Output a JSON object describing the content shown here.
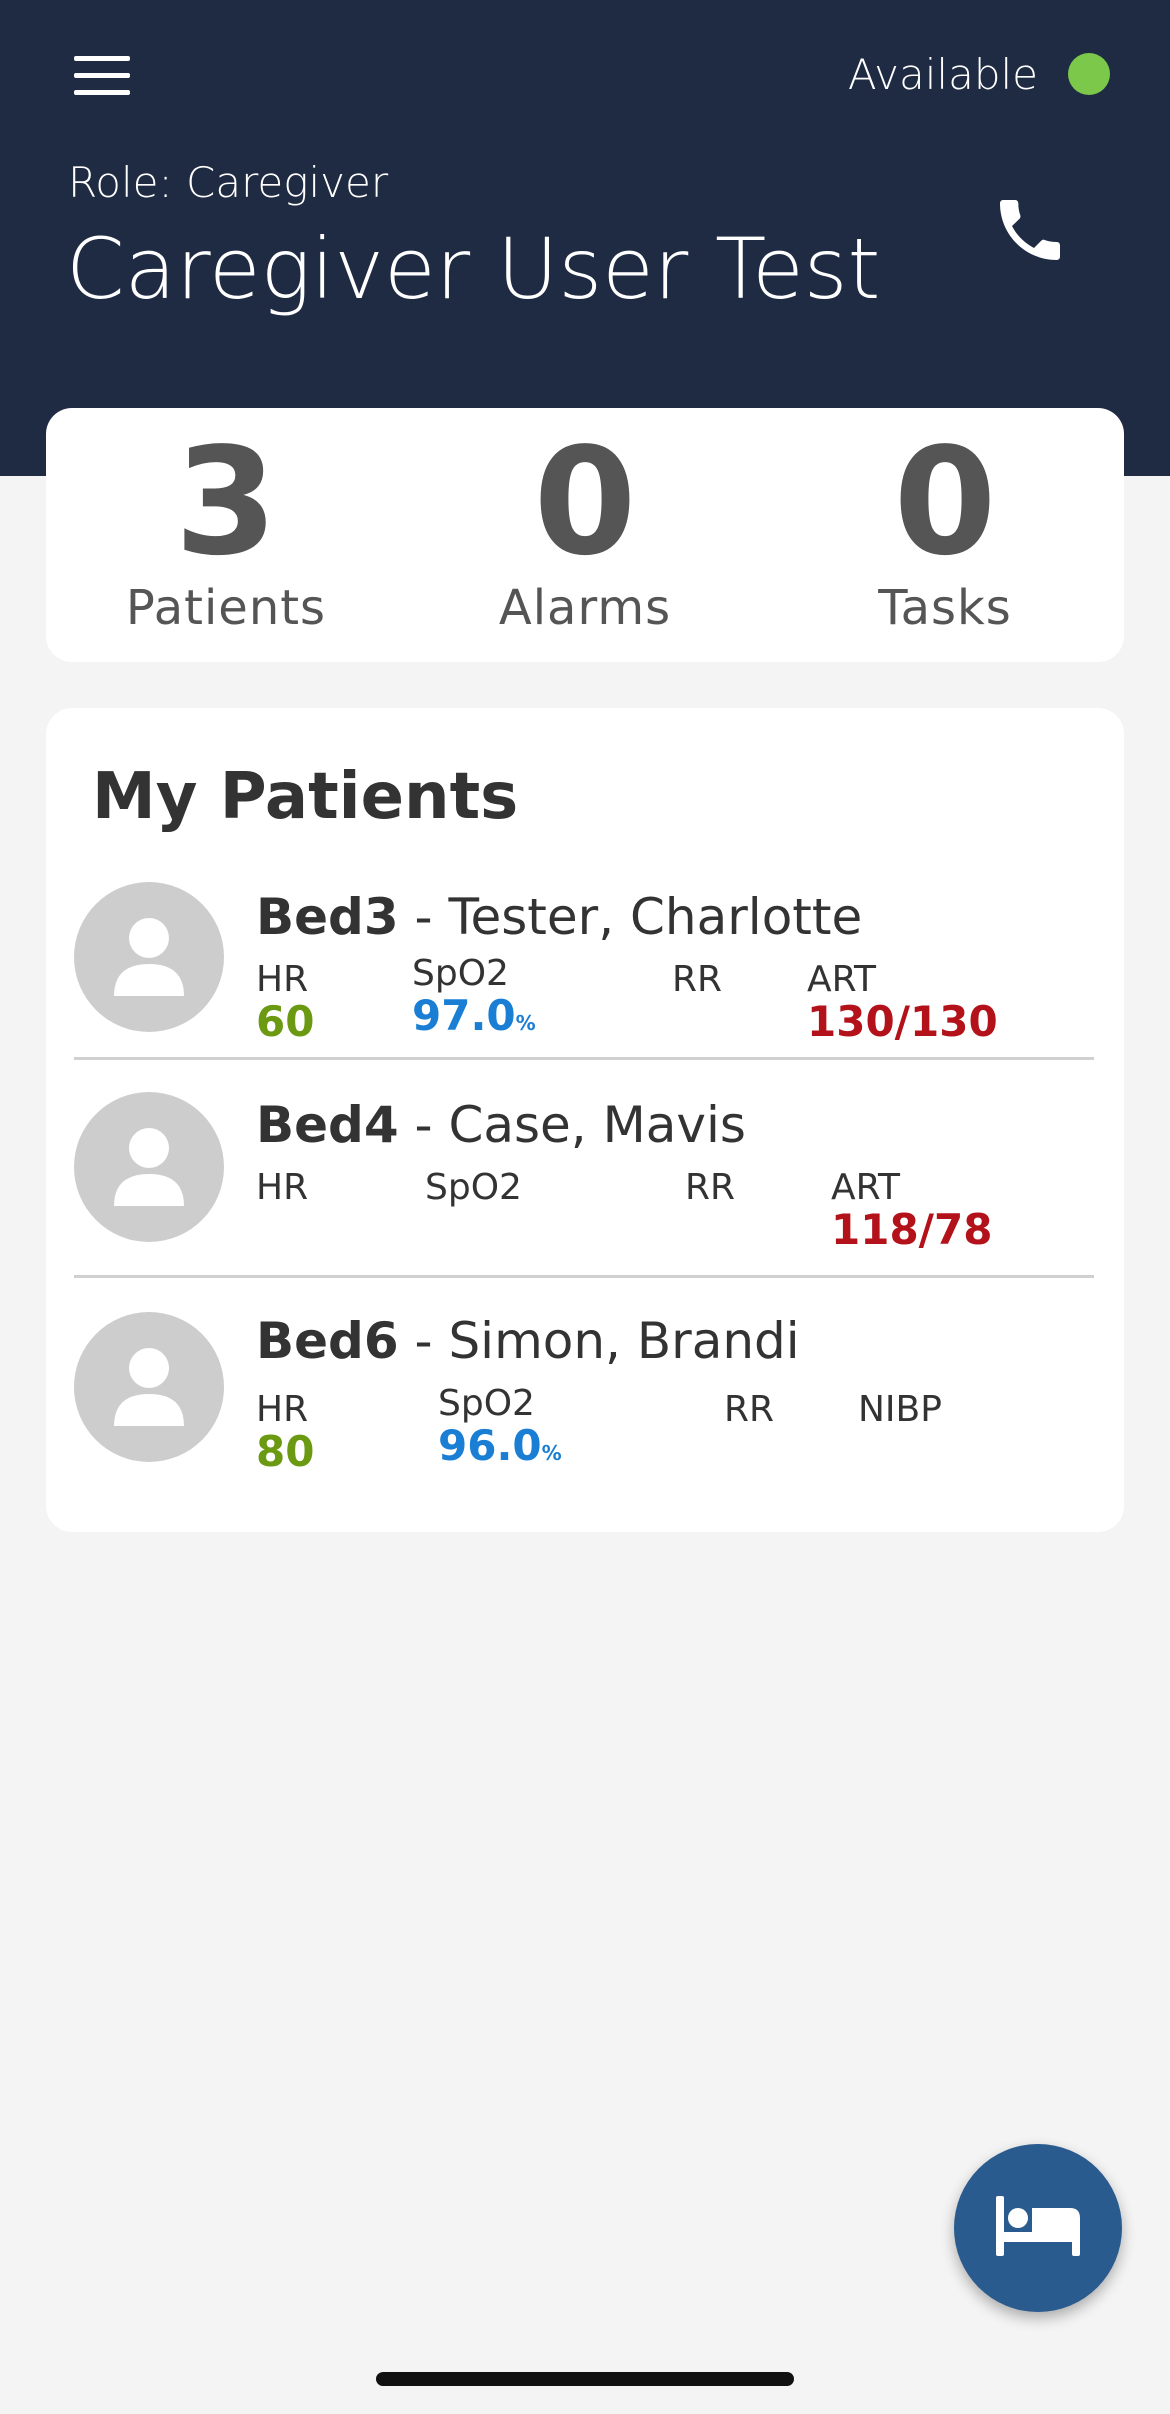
{
  "header": {
    "status_label": "Available",
    "status_color": "#7bc84a",
    "role": "Role: Caregiver",
    "user_name": "Caregiver User Test",
    "menu_icon": "hamburger-menu-icon",
    "call_icon": "phone-icon"
  },
  "summary": {
    "patients_value": "3",
    "patients_label": "Patients",
    "alarms_value": "0",
    "alarms_label": "Alarms",
    "tasks_value": "0",
    "tasks_label": "Tasks"
  },
  "my_patients": {
    "title": "My Patients",
    "patients": [
      {
        "bed": "Bed3",
        "name": " - Tester, Charlotte",
        "vitals": {
          "hr_label": "HR",
          "hr_value": "60",
          "spo2_label": "SpO2",
          "spo2_value": "97.0",
          "spo2_unit": "%",
          "rr_label": "RR",
          "rr_value": "",
          "bp_label": "ART",
          "bp_value": "130/130"
        }
      },
      {
        "bed": "Bed4",
        "name": " - Case, Mavis",
        "vitals": {
          "hr_label": "HR",
          "hr_value": "",
          "spo2_label": "SpO2",
          "spo2_value": "",
          "spo2_unit": "",
          "rr_label": "RR",
          "rr_value": "",
          "bp_label": "ART",
          "bp_value": "118/78"
        }
      },
      {
        "bed": "Bed6",
        "name": " - Simon, Brandi",
        "vitals": {
          "hr_label": "HR",
          "hr_value": "80",
          "spo2_label": "SpO2",
          "spo2_value": "96.0",
          "spo2_unit": "%",
          "rr_label": "RR",
          "rr_value": "",
          "bp_label": "NIBP",
          "bp_value": ""
        }
      }
    ]
  },
  "colors": {
    "header_bg": "#1f2b42",
    "hr": "#6b9a12",
    "spo2": "#1a7fd4",
    "bp": "#b3121a",
    "fab": "#2a5b8e"
  },
  "fab": {
    "icon": "bed-icon"
  }
}
